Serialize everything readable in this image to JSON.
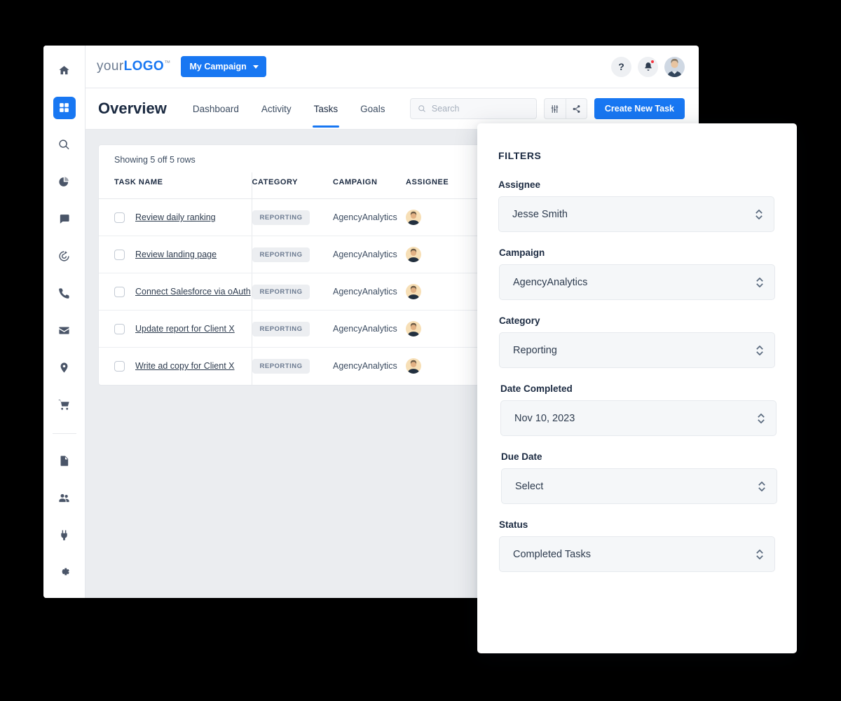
{
  "sidebar": {
    "items": [
      {
        "name": "home",
        "icon": "home-icon"
      },
      {
        "name": "dashboard",
        "icon": "grid-icon",
        "active": true
      },
      {
        "name": "search",
        "icon": "search-icon"
      },
      {
        "name": "analytics",
        "icon": "pie-chart-icon"
      },
      {
        "name": "messages",
        "icon": "chat-bubble-icon"
      },
      {
        "name": "target",
        "icon": "target-icon"
      },
      {
        "name": "calls",
        "icon": "phone-icon"
      },
      {
        "name": "email",
        "icon": "envelope-icon"
      },
      {
        "name": "locations",
        "icon": "map-pin-icon"
      },
      {
        "name": "ecommerce",
        "icon": "shopping-cart-icon"
      },
      {
        "name": "documents",
        "icon": "document-icon"
      },
      {
        "name": "team",
        "icon": "people-icon"
      },
      {
        "name": "integrations",
        "icon": "plug-icon"
      },
      {
        "name": "settings",
        "icon": "gear-icon"
      }
    ]
  },
  "topbar": {
    "logo_prefix": "your",
    "logo_suffix": "LOGO",
    "logo_tm": "™",
    "campaign_button": "My Campaign",
    "help_label": "?",
    "icons": {
      "help": "question-mark-icon",
      "notifications": "bell-icon",
      "avatar": "user-avatar"
    }
  },
  "tabbar": {
    "page_title": "Overview",
    "tabs": [
      {
        "label": "Dashboard",
        "active": false
      },
      {
        "label": "Activity",
        "active": false
      },
      {
        "label": "Tasks",
        "active": true
      },
      {
        "label": "Goals",
        "active": false
      }
    ],
    "search_placeholder": "Search",
    "search_value": "",
    "filter_icon": "sliders-icon",
    "share_icon": "share-icon",
    "create_button": "Create New Task"
  },
  "table": {
    "showing_text": "Showing 5 off 5 rows",
    "columns": [
      "TASK NAME",
      "CATEGORY",
      "CAMPAIGN",
      "ASSIGNEE"
    ],
    "rows": [
      {
        "task": "Review daily ranking",
        "category": "REPORTING",
        "campaign": "AgencyAnalytics",
        "checked": false
      },
      {
        "task": "Review landing page",
        "category": "REPORTING",
        "campaign": "AgencyAnalytics",
        "checked": false
      },
      {
        "task": "Connect Salesforce via oAuth",
        "category": "REPORTING",
        "campaign": "AgencyAnalytics",
        "checked": false
      },
      {
        "task": "Update report for Client X",
        "category": "REPORTING",
        "campaign": "AgencyAnalytics",
        "checked": false
      },
      {
        "task": "Write ad copy for Client X",
        "category": "REPORTING",
        "campaign": "AgencyAnalytics",
        "checked": false
      }
    ]
  },
  "filters": {
    "title": "FILTERS",
    "fields": [
      {
        "label": "Assignee",
        "value": "Jesse Smith"
      },
      {
        "label": "Campaign",
        "value": "AgencyAnalytics"
      },
      {
        "label": "Category",
        "value": "Reporting"
      },
      {
        "label": "Date Completed",
        "value": "Nov 10, 2023"
      },
      {
        "label": "Due Date",
        "value": "Select"
      },
      {
        "label": "Status",
        "value": "Completed Tasks"
      }
    ]
  },
  "colors": {
    "accent": "#1877f2",
    "text_dark": "#1b2a41",
    "text_muted": "#6b7a90",
    "canvas": "#ebedf0",
    "field_bg": "#f5f7f9",
    "notification": "#f5333f"
  }
}
